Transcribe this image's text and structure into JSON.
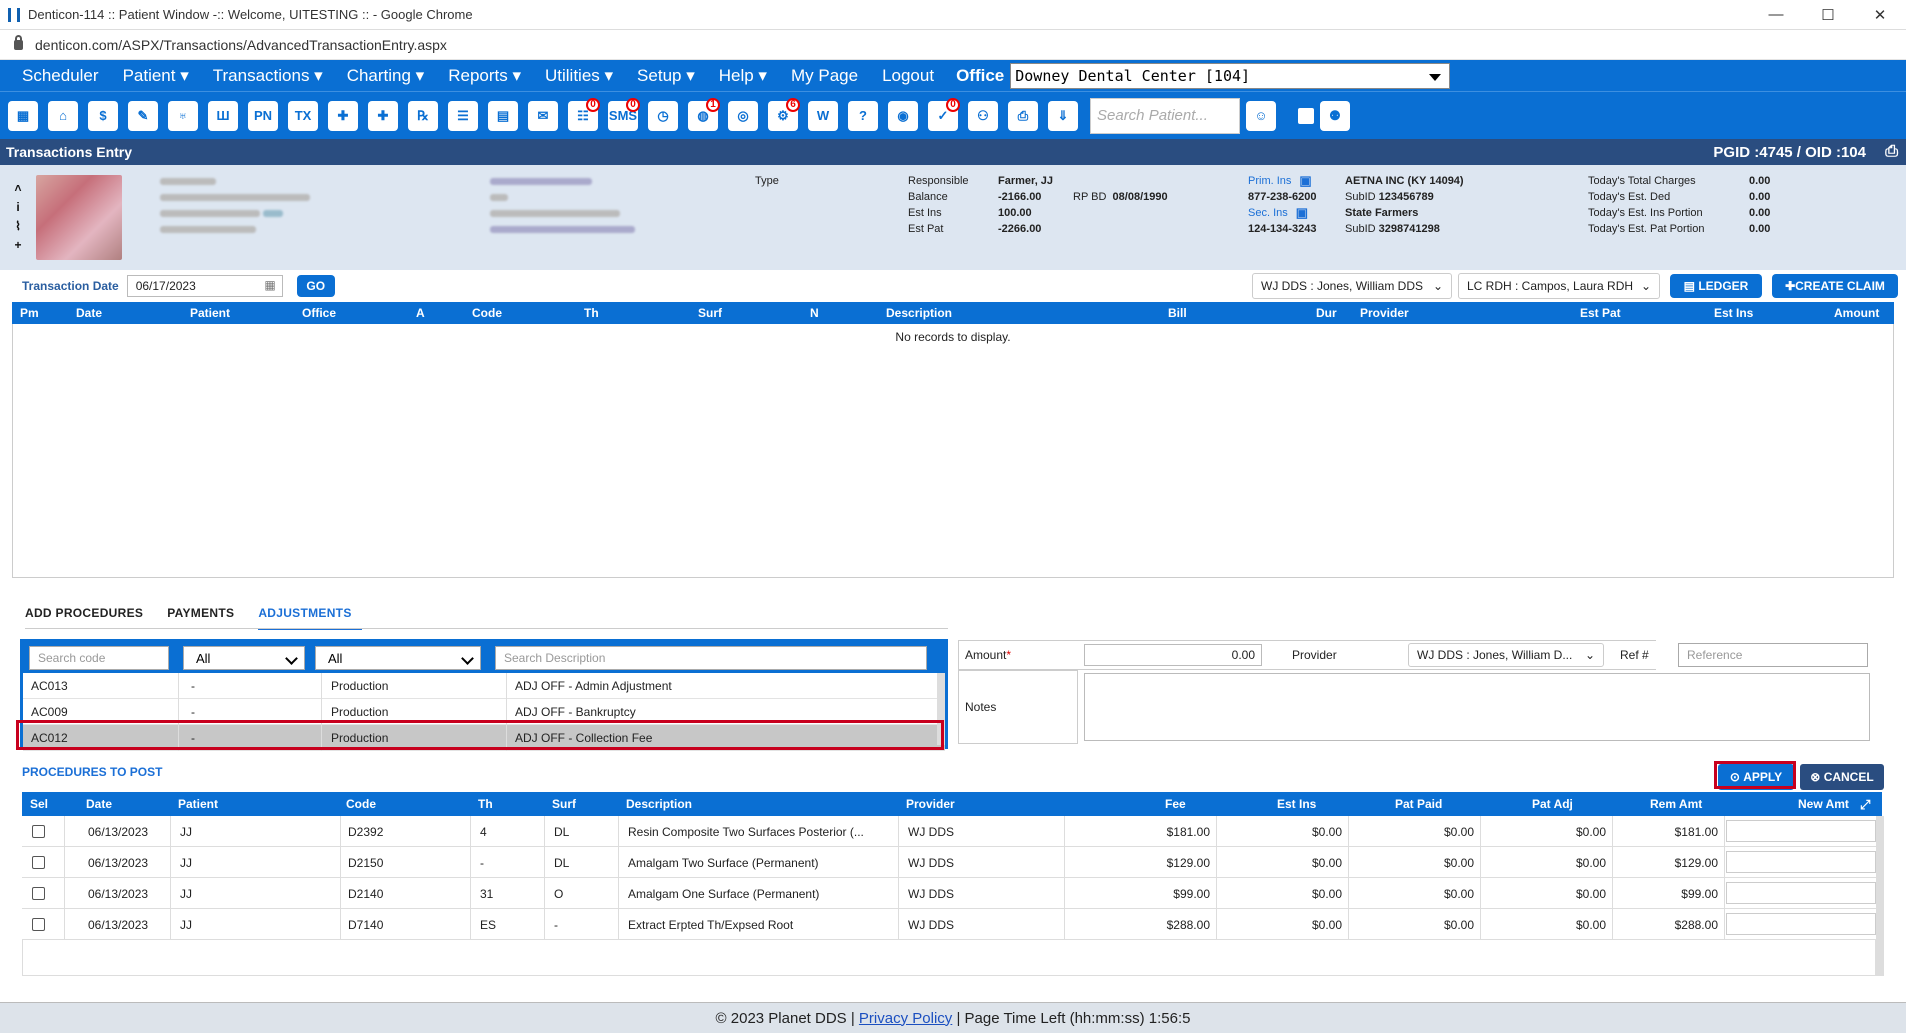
{
  "browser": {
    "title": "Denticon-114 :: Patient Window -:: Welcome, UITESTING :: - Google Chrome",
    "url": "denticon.com/ASPX/Transactions/AdvancedTransactionEntry.aspx",
    "controls": [
      "—",
      "☐",
      "✕"
    ]
  },
  "menu": {
    "items": [
      "Scheduler",
      "Patient ▾",
      "Transactions ▾",
      "Charting ▾",
      "Reports ▾",
      "Utilities ▾",
      "Setup ▾",
      "Help ▾",
      "My Page",
      "Logout"
    ],
    "office_label": "Office",
    "office_value": "Downey Dental Center [104]"
  },
  "toolbar": {
    "icons": [
      "calendar-icon",
      "home-icon",
      "dollar-icon",
      "edit-icon",
      "tooth-icon",
      "tooth-chart-icon",
      "pn-icon",
      "tx-icon",
      "add-user-icon",
      "add-group-icon",
      "rx-icon",
      "note-icon",
      "print-doc-icon",
      "mail-icon",
      "chat-icon",
      "sms-icon",
      "clock-icon",
      "globe-icon",
      "support-icon",
      "settings-icon",
      "tooth-outline-icon",
      "help-icon",
      "web-icon",
      "doc-check-icon",
      "team-icon",
      "printer-icon",
      "download-icon"
    ],
    "badges": {
      "chat": "0",
      "sms": "0",
      "globe": "1",
      "settings": "6",
      "doc-check": "0"
    },
    "search_placeholder": "Search Patient..."
  },
  "section": {
    "title": "Transactions Entry",
    "ids": "PGID :4745  /  OID :104"
  },
  "patient": {
    "type_label": "Type",
    "responsible_label": "Responsible",
    "responsible_value": "Farmer, JJ",
    "balance_label": "Balance",
    "balance_value": "-2166.00",
    "rpbd_label": "RP BD",
    "rpbd_value": "08/08/1990",
    "estins_label": "Est Ins",
    "estins_value": "100.00",
    "estpat_label": "Est Pat",
    "estpat_value": "-2266.00",
    "prim_ins_label": "Prim. Ins",
    "prim_ins_phone": "877-238-6200",
    "prim_ins_name": "AETNA INC (KY 14094)",
    "prim_subid_label": "SubID",
    "prim_subid": "123456789",
    "sec_ins_label": "Sec. Ins",
    "sec_ins_phone": "124-134-3243",
    "sec_ins_name": "State Farmers",
    "sec_subid_label": "SubID",
    "sec_subid": "3298741298",
    "today_charges_label": "Today's Total Charges",
    "today_charges": "0.00",
    "today_ded_label": "Today's Est. Ded",
    "today_ded": "0.00",
    "today_ins_label": "Today's Est. Ins Portion",
    "today_ins": "0.00",
    "today_pat_label": "Today's Est. Pat Portion",
    "today_pat": "0.00"
  },
  "transaction": {
    "date_label": "Transaction Date",
    "date_value": "06/17/2023",
    "go_label": "GO",
    "provider1": "WJ DDS : Jones, William DDS",
    "provider2": "LC RDH : Campos, Laura RDH",
    "ledger_label": "LEDGER",
    "create_claim_label": "CREATE CLAIM",
    "columns": [
      "Pm",
      "Date",
      "Patient",
      "Office",
      "A",
      "Code",
      "Th",
      "Surf",
      "N",
      "Description",
      "Bill",
      "Dur",
      "Provider",
      "Est Pat",
      "Est Ins",
      "Amount"
    ],
    "empty_text": "No records to display."
  },
  "tabs": [
    "ADD PROCEDURES",
    "PAYMENTS",
    "ADJUSTMENTS"
  ],
  "adjustments": {
    "search_code_placeholder": "Search code",
    "filter1": "All",
    "filter2": "All",
    "search_desc_placeholder": "Search Description",
    "rows": [
      {
        "code": "AC013",
        "dash": "-",
        "type": "Production",
        "desc": "ADJ OFF - Admin Adjustment"
      },
      {
        "code": "AC009",
        "dash": "-",
        "type": "Production",
        "desc": "ADJ OFF - Bankruptcy"
      },
      {
        "code": "AC012",
        "dash": "-",
        "type": "Production",
        "desc": "ADJ OFF - Collection Fee"
      }
    ]
  },
  "amount_panel": {
    "amount_label": "Amount",
    "required_mark": "*",
    "amount_value": "0.00",
    "provider_label": "Provider",
    "provider_value": "WJ DDS : Jones, William D...",
    "ref_label": "Ref #",
    "ref_placeholder": "Reference",
    "notes_label": "Notes"
  },
  "procedures": {
    "title": "PROCEDURES TO POST",
    "apply_label": "APPLY",
    "cancel_label": "CANCEL",
    "columns": [
      "Sel",
      "Date",
      "Patient",
      "Code",
      "Th",
      "Surf",
      "Description",
      "Provider",
      "Fee",
      "Est Ins",
      "Pat Paid",
      "Pat Adj",
      "Rem Amt",
      "New Amt"
    ],
    "rows": [
      {
        "date": "06/13/2023",
        "patient": "JJ",
        "code": "D2392",
        "th": "4",
        "surf": "DL",
        "desc": "Resin Composite Two Surfaces Posterior (...",
        "provider": "WJ DDS",
        "fee": "$181.00",
        "estins": "$0.00",
        "patpaid": "$0.00",
        "patadj": "$0.00",
        "rem": "$181.00"
      },
      {
        "date": "06/13/2023",
        "patient": "JJ",
        "code": "D2150",
        "th": "-",
        "surf": "DL",
        "desc": "Amalgam Two Surface (Permanent)",
        "provider": "WJ DDS",
        "fee": "$129.00",
        "estins": "$0.00",
        "patpaid": "$0.00",
        "patadj": "$0.00",
        "rem": "$129.00"
      },
      {
        "date": "06/13/2023",
        "patient": "JJ",
        "code": "D2140",
        "th": "31",
        "surf": "O",
        "desc": "Amalgam One Surface (Permanent)",
        "provider": "WJ DDS",
        "fee": "$99.00",
        "estins": "$0.00",
        "patpaid": "$0.00",
        "patadj": "$0.00",
        "rem": "$99.00"
      },
      {
        "date": "06/13/2023",
        "patient": "JJ",
        "code": "D7140",
        "th": "ES",
        "surf": "-",
        "desc": "Extract Erpted Th/Expsed Root",
        "provider": "WJ DDS",
        "fee": "$288.00",
        "estins": "$0.00",
        "patpaid": "$0.00",
        "patadj": "$0.00",
        "rem": "$288.00"
      }
    ]
  },
  "footer": {
    "copyright": "© 2023 Planet DDS |",
    "privacy": "Privacy Policy",
    "time": "| Page Time Left (hh:mm:ss) 1:56:5"
  }
}
